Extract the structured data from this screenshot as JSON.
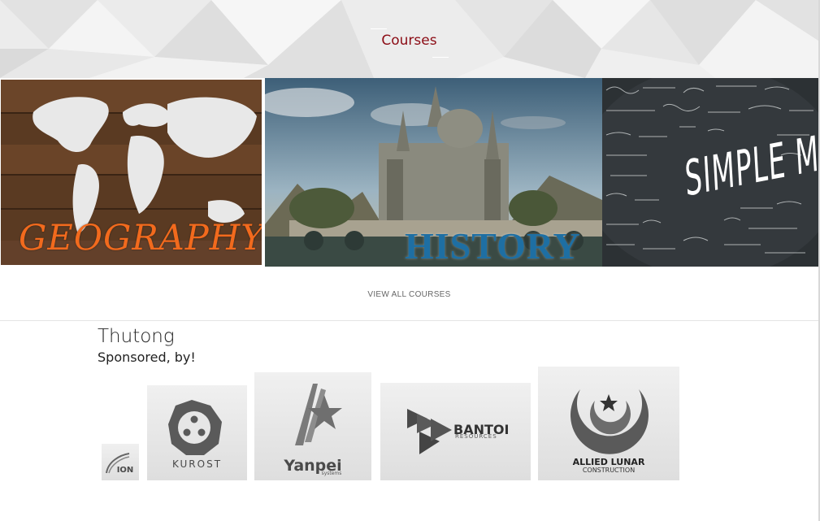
{
  "section": {
    "title": "Courses"
  },
  "courses": [
    {
      "label": "GEOGRAPHY"
    },
    {
      "label": "HISTORY"
    },
    {
      "label": "SIMPLE MA"
    }
  ],
  "view_all": "VIEW ALL COURSES",
  "footer": {
    "site_name": "Thutong",
    "sponsored_by": "Sponsored, by!"
  },
  "sponsors": [
    {
      "name": "ION",
      "icon": "ion-logo-icon"
    },
    {
      "name": "KUROST",
      "icon": "kurost-logo-icon"
    },
    {
      "name": "Yanpei",
      "sub": "systems",
      "icon": "yanpei-logo-icon"
    },
    {
      "name": "BANTOI",
      "sub": "RESOURCES",
      "icon": "bantoi-logo-icon"
    },
    {
      "name": "ALLIED LUNAR",
      "sub": "CONSTRUCTION",
      "icon": "allied-lunar-logo-icon"
    }
  ],
  "colors": {
    "section_title": "#8b0b14",
    "geography_label": "#f26a1d",
    "history_label": "#1e6fa3"
  }
}
